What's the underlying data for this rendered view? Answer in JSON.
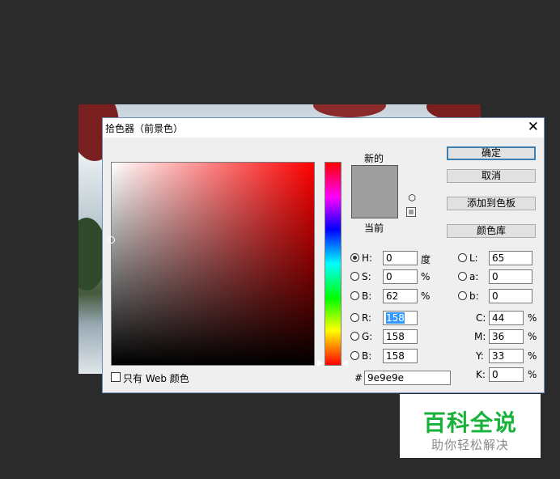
{
  "dialog": {
    "title": "拾色器（前景色）",
    "close_symbol": "✕"
  },
  "swatch": {
    "new_label": "新的",
    "current_label": "当前",
    "new_color": "#9e9e9e",
    "current_color": "#9e9e9e"
  },
  "buttons": {
    "ok": "确定",
    "cancel": "取消",
    "add_to_swatches": "添加到色板",
    "color_libraries": "颜色库"
  },
  "hsb": {
    "h": {
      "label": "H:",
      "value": "0",
      "unit": "度",
      "selected": true
    },
    "s": {
      "label": "S:",
      "value": "0",
      "unit": "%"
    },
    "b": {
      "label": "B:",
      "value": "62",
      "unit": "%"
    }
  },
  "rgb": {
    "r": {
      "label": "R:",
      "value": "158"
    },
    "g": {
      "label": "G:",
      "value": "158"
    },
    "b": {
      "label": "B:",
      "value": "158"
    }
  },
  "lab": {
    "l": {
      "label": "L:",
      "value": "65"
    },
    "a": {
      "label": "a:",
      "value": "0"
    },
    "b": {
      "label": "b:",
      "value": "0"
    }
  },
  "cmyk": {
    "c": {
      "label": "C:",
      "value": "44",
      "unit": "%"
    },
    "m": {
      "label": "M:",
      "value": "36",
      "unit": "%"
    },
    "y": {
      "label": "Y:",
      "value": "33",
      "unit": "%"
    },
    "k": {
      "label": "K:",
      "value": "0",
      "unit": "%"
    }
  },
  "hex": {
    "label": "#",
    "value": "9e9e9e"
  },
  "web_only": {
    "label": "只有 Web 颜色",
    "checked": false
  },
  "watermark": {
    "main": "百科全说",
    "sub": "助你轻松解决"
  },
  "colors": {
    "accent": "#3c7fb1",
    "watermark_green": "#18b23a"
  }
}
